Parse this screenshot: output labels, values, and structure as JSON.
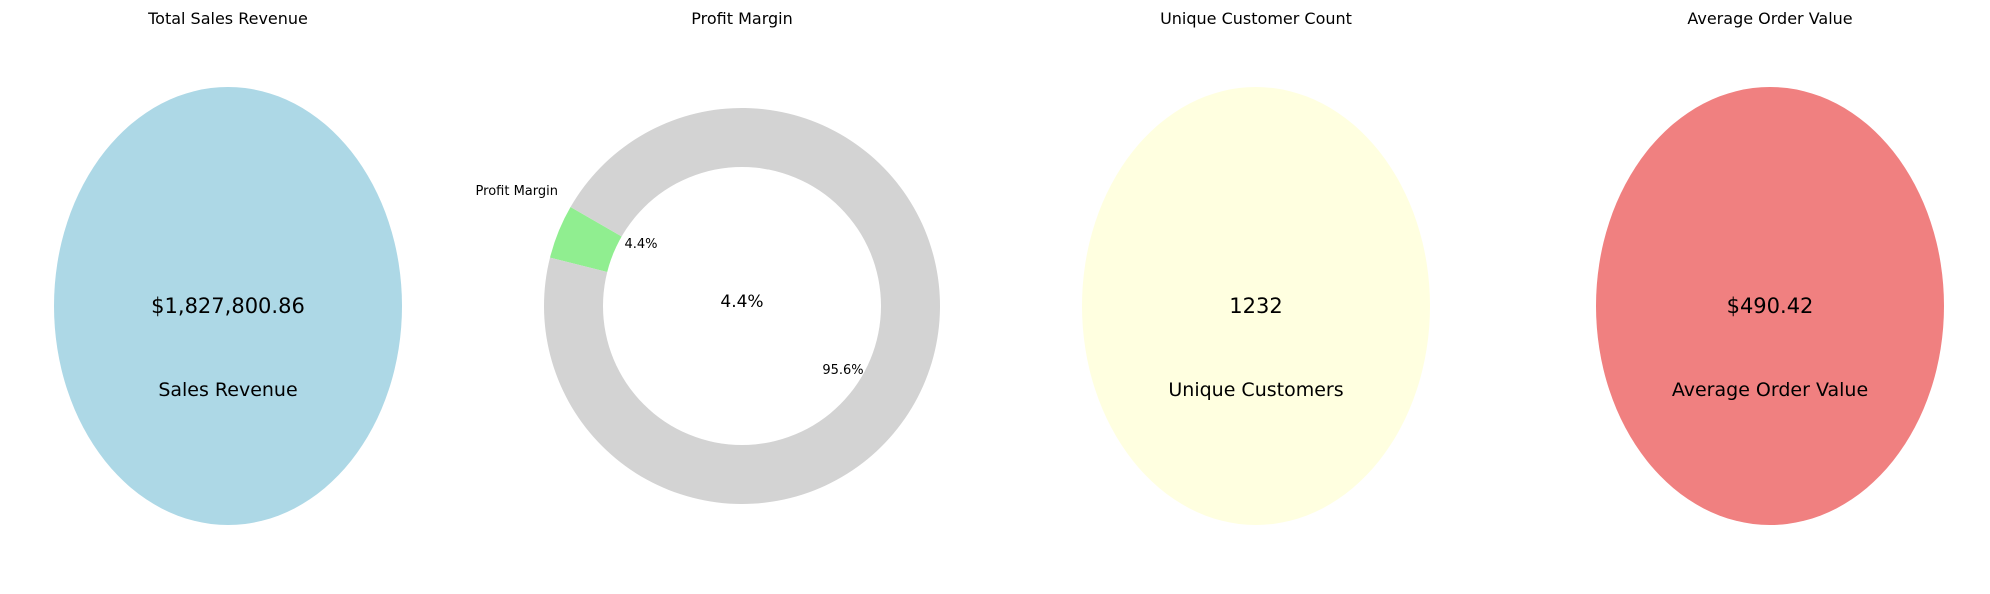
{
  "chart_data": [
    {
      "type": "pie",
      "title": "Total Sales Revenue",
      "slices": [
        {
          "label": "",
          "value": 1827800.86,
          "color": "#add8e6"
        }
      ],
      "value_text": "$1,827,800.86",
      "caption": "Sales Revenue"
    },
    {
      "type": "pie",
      "title": "Profit Margin",
      "donut": true,
      "slices": [
        {
          "label": "Profit Margin",
          "value": 4.4,
          "pct_text": "4.4%",
          "color": "#90ee90"
        },
        {
          "label": "",
          "value": 95.6,
          "pct_text": "95.6%",
          "color": "#d3d3d3"
        }
      ],
      "center_text": "4.4%"
    },
    {
      "type": "pie",
      "title": "Unique Customer Count",
      "slices": [
        {
          "label": "",
          "value": 1232,
          "color": "#ffffe0"
        }
      ],
      "value_text": "1232",
      "caption": "Unique Customers"
    },
    {
      "type": "pie",
      "title": "Average Order Value",
      "slices": [
        {
          "label": "",
          "value": 490.42,
          "color": "#f08080"
        }
      ],
      "value_text": "$490.42",
      "caption": "Average Order Value"
    }
  ]
}
